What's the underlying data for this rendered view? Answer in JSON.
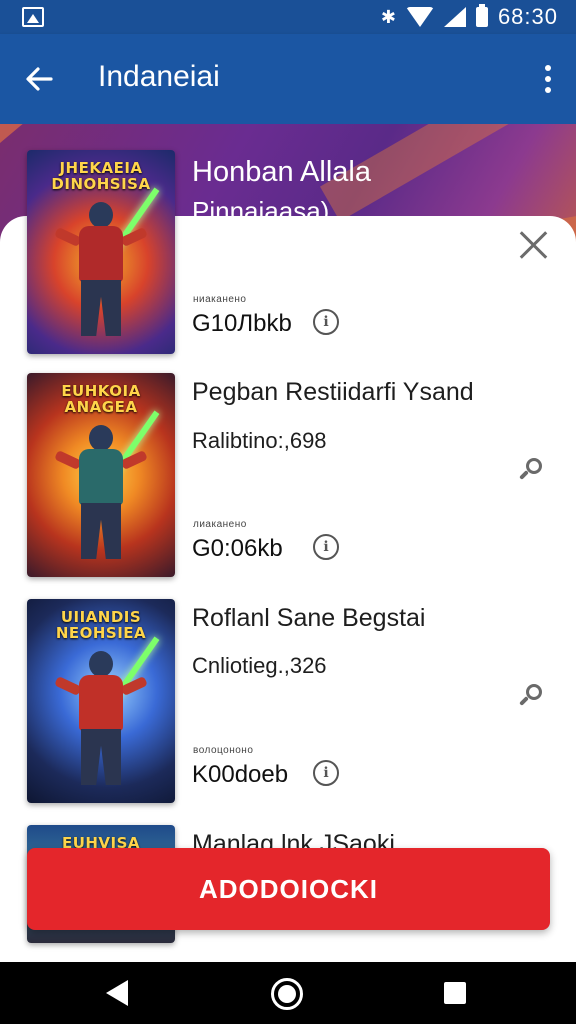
{
  "status_bar": {
    "time": "68:30",
    "bluetooth_glyph": "✱"
  },
  "app_bar": {
    "title": "Indaneiai",
    "back_glyph": "←"
  },
  "hero": {
    "title": "Honban Allala",
    "subtitle": "Pinnaiaasa)"
  },
  "items": [
    {
      "meta": "ниаканено",
      "size": "G10Лbkb",
      "info_glyph": "ℹ"
    },
    {
      "title": "Pegban Restiidarfi Ysand",
      "subtitle": "Ralibtino:,698",
      "meta": "лиаканено",
      "size": "G0:06kb",
      "info_glyph": "ℹ"
    },
    {
      "title": "Roflanl Sane Begstai",
      "subtitle": "Cnliotieg.,326",
      "meta": "волоцононо",
      "size": "K00doeb",
      "info_glyph": "ℹ"
    },
    {
      "title": "Manlag lnk JSaoki"
    }
  ],
  "covers": [
    {
      "title": "JHEKAEIA DINOHSISA"
    },
    {
      "title": "EUHKOIA ANAGEA"
    },
    {
      "title": "UIIANDIS NEOHSIEA"
    },
    {
      "title": "EUHVISA"
    }
  ],
  "cta": {
    "label": "ADODOIOCKI"
  },
  "colors": {
    "app_bar": "#1b56a3",
    "status_bar": "#1a5097",
    "cta": "#e4262b",
    "nav_bar": "#000000"
  },
  "icons": [
    "back-arrow-icon",
    "more-vert-icon",
    "close-icon",
    "info-icon",
    "search-icon",
    "nav-back-icon",
    "nav-home-icon",
    "nav-recents-icon"
  ]
}
